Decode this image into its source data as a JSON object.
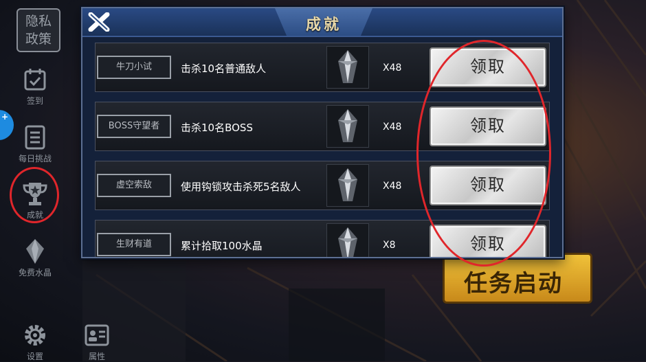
{
  "sidebar": {
    "privacy": "隐私政策",
    "items": [
      {
        "label": "签到",
        "icon": "calendar-icon"
      },
      {
        "label": "每日挑战",
        "icon": "list-icon"
      },
      {
        "label": "成就",
        "icon": "trophy-icon"
      },
      {
        "label": "免费水晶",
        "icon": "crystal-icon"
      },
      {
        "label": "设置",
        "icon": "gear-icon"
      },
      {
        "label": "属性",
        "icon": "id-card-icon"
      }
    ],
    "badge": "+"
  },
  "panel": {
    "title": "成就",
    "close_icon": "close-icon",
    "achievements": [
      {
        "name": "牛刀小试",
        "desc": "击杀10名普通敌人",
        "reward_icon": "crystal-icon",
        "qty": "X48",
        "button": "领取"
      },
      {
        "name": "BOSS守望者",
        "desc": "击杀10名BOSS",
        "reward_icon": "crystal-icon",
        "qty": "X48",
        "button": "领取"
      },
      {
        "name": "虚空索敌",
        "desc": "使用钩锁攻击杀死5名敌人",
        "reward_icon": "crystal-icon",
        "qty": "X48",
        "button": "领取"
      },
      {
        "name": "生财有道",
        "desc": "累计拾取100水晶",
        "reward_icon": "crystal-icon",
        "qty": "X8",
        "button": "领取"
      }
    ]
  },
  "task_button": "任务启动",
  "colors": {
    "annotation_red": "#e0262b",
    "panel_bg": "#14213a",
    "title_gold": "#e8d8a8",
    "task_gold": "#f0c23a"
  }
}
